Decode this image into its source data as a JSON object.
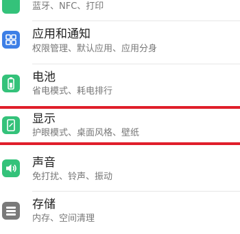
{
  "colors": {
    "connectivity": "#34c27a",
    "apps": "#3d7fe6",
    "battery": "#34c27a",
    "display": "#34c27a",
    "sound": "#34c27a",
    "storage": "#7a7a7a",
    "highlight": "#e01e2a"
  },
  "items": [
    {
      "subtitle": "蓝牙、NFC、打印",
      "icon": "link-icon"
    },
    {
      "title": "应用和通知",
      "subtitle": "权限管理、默认应用、应用分身",
      "icon": "apps-grid-icon"
    },
    {
      "title": "电池",
      "subtitle": "省电模式、耗电排行",
      "icon": "battery-icon"
    },
    {
      "title": "显示",
      "subtitle": "护眼模式、桌面风格、壁纸",
      "icon": "display-icon"
    },
    {
      "title": "声音",
      "subtitle": "免打扰、铃声、振动",
      "icon": "speaker-icon"
    },
    {
      "title": "存储",
      "subtitle": "内存、空间清理",
      "icon": "storage-icon"
    }
  ]
}
